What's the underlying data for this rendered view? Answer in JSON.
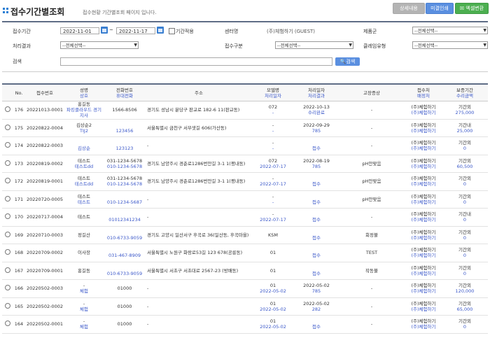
{
  "header": {
    "title": "접수기간별조회",
    "description": "접수현황 기간별조회 페이지 입니다.",
    "buttons": [
      "상세내용",
      "미결인쇄",
      "엑셀변환"
    ]
  },
  "filter": {
    "period_label": "접수기간",
    "date_from": "2022-11-01",
    "date_sep": "~",
    "date_to": "2022-11-17",
    "period_apply_label": "기간적용",
    "center_label": "센터명",
    "center_value": "(주)체험하기 (GUEST)",
    "product_label": "제품군",
    "product_value": "--전체선택--",
    "result_label": "처리결과",
    "result_value": "--전체선택--",
    "receipt_type_label": "접수구분",
    "receipt_type_value": "--전체선택--",
    "claim_type_label": "클레임유형",
    "claim_type_value": "--전체선택--",
    "search_label": "검색",
    "search_value": "",
    "search_button": "검색"
  },
  "table": {
    "headers": [
      {
        "top": "No.",
        "bottom": ""
      },
      {
        "top": "접수번호",
        "bottom": ""
      },
      {
        "top": "성명",
        "bottom": "상호"
      },
      {
        "top": "전화번호",
        "bottom": "휴대전화"
      },
      {
        "top": "주소",
        "bottom": ""
      },
      {
        "top": "모델명",
        "bottom": "처리일자"
      },
      {
        "top": "처리일자",
        "bottom": "처리결과"
      },
      {
        "top": "고장증상",
        "bottom": ""
      },
      {
        "top": "접수처",
        "bottom": "배정처"
      },
      {
        "top": "보증기간",
        "bottom": "수리금액"
      }
    ],
    "rows": [
      {
        "no": "176",
        "receipt": "20221013-0001",
        "name": "홍길동",
        "company": "파킹클라우드 경기지사",
        "phone": "1566-8506",
        "mobile": "",
        "address": "경기도 성남시 분당구 판교로 182-6 11(판교동)",
        "model": "072",
        "model_date": "-",
        "proc_date": "2022-10-13",
        "proc_result": "수리완료",
        "symptom": "-",
        "reception": "(주)체험하기",
        "assignee": "(주)체험하기",
        "warranty": "기간외",
        "amount": "275,000"
      },
      {
        "no": "175",
        "receipt": "20220822-0004",
        "name": "김상순2",
        "company": "TIJ2",
        "phone": "",
        "mobile": "123456",
        "address": "서울특별시 금천구 서부샛길 606(가산동)",
        "model": "-",
        "model_date": "-",
        "proc_date": "2022-09-29",
        "proc_result": "785",
        "symptom": "-",
        "reception": "(주)체험하기",
        "assignee": "(주)체험하기",
        "warranty": "기간내",
        "amount": "25,000"
      },
      {
        "no": "174",
        "receipt": "20220822-0003",
        "name": "",
        "company": "김상순",
        "phone": "",
        "mobile": "123123",
        "address": "-",
        "model": "-",
        "model_date": "-",
        "proc_date": "",
        "proc_result": "접수",
        "symptom": "-",
        "reception": "(주)체험하기",
        "assignee": "(주)체험하기",
        "warranty": "기간외",
        "amount": "0"
      },
      {
        "no": "173",
        "receipt": "20220819-0002",
        "name": "테스트",
        "company": "테스트dd",
        "phone": "031-1234-5678",
        "mobile": "010-1234-5678",
        "address": "경기도 남양주시 경춘로1286번안길 3-1 1(평내동)",
        "model": "072",
        "model_date": "2022-07-17",
        "proc_date": "2022-08-19",
        "proc_result": "785",
        "symptom": "pH안맞음",
        "reception": "(주)체험하기",
        "assignee": "(주)체험하기",
        "warranty": "기간외",
        "amount": "60,500"
      },
      {
        "no": "172",
        "receipt": "20220819-0001",
        "name": "테스트",
        "company": "테스트dd",
        "phone": "031-1234-5678",
        "mobile": "010-1234-5678",
        "address": "경기도 남양주시 경춘로1286번안길 3-1 1(평내동)",
        "model": "-",
        "model_date": "2022-07-17",
        "proc_date": "",
        "proc_result": "접수",
        "symptom": "pH안맞음",
        "reception": "(주)체험하기",
        "assignee": "(주)체험하기",
        "warranty": "기간외",
        "amount": "0"
      },
      {
        "no": "171",
        "receipt": "20220720-0005",
        "name": "테스트",
        "company": "테스트",
        "phone": "",
        "mobile": "010-1234-5687",
        "address": "-",
        "model": "-",
        "model_date": "-",
        "proc_date": "",
        "proc_result": "접수",
        "symptom": "pH안맞음",
        "reception": "(주)체험하기",
        "assignee": "(주)체험하기",
        "warranty": "기간외",
        "amount": "0"
      },
      {
        "no": "170",
        "receipt": "20220717-0004",
        "name": "테스트",
        "company": "",
        "phone": "",
        "mobile": "01012341234",
        "address": "-",
        "model": "-",
        "model_date": "2022-07-17",
        "proc_date": "",
        "proc_result": "접수",
        "symptom": "-",
        "reception": "(주)체험하기",
        "assignee": "(주)체험하기",
        "warranty": "기간내",
        "amount": "0"
      },
      {
        "no": "169",
        "receipt": "20220710-0003",
        "name": "정길산",
        "company": "",
        "phone": "",
        "mobile": "010-6733-9059",
        "address": "경기도 고양시 일산서구 후곡로 36(일산동, 후곡마을)",
        "model": "KSM",
        "model_date": "",
        "proc_date": "",
        "proc_result": "접수",
        "symptom": "회정불",
        "reception": "(주)체험하기",
        "assignee": "(주)체험하기",
        "warranty": "기간외",
        "amount": "0"
      },
      {
        "no": "168",
        "receipt": "20220709-0002",
        "name": "이사장",
        "company": "",
        "phone": "",
        "mobile": "031-467-8909",
        "address": "서울특별시 노원구 화랑로53길 123 678(공릉동)",
        "model": "01",
        "model_date": "",
        "proc_date": "",
        "proc_result": "접수",
        "symptom": "TEST",
        "reception": "(주)체험하기",
        "assignee": "(주)체험하기",
        "warranty": "기간외",
        "amount": "0"
      },
      {
        "no": "167",
        "receipt": "20220709-0001",
        "name": "홍길동",
        "company": "",
        "phone": "",
        "mobile": "010-6733-9059",
        "address": "서울특별시 서초구 서초대로 2567-23 (방배동)",
        "model": "01",
        "model_date": "",
        "proc_date": "",
        "proc_result": "접수",
        "symptom": "작동불",
        "reception": "(주)체험하기",
        "assignee": "(주)체험하기",
        "warranty": "기간외",
        "amount": "0"
      },
      {
        "no": "166",
        "receipt": "20220502-0003",
        "name": "-",
        "company": "체험",
        "phone": "01000",
        "mobile": "",
        "address": "-",
        "model": "01",
        "model_date": "2022-05-02",
        "proc_date": "2022-05-02",
        "proc_result": "785",
        "symptom": "-",
        "reception": "(주)체험하기",
        "assignee": "(주)체험하기",
        "warranty": "기간외",
        "amount": "120,000"
      },
      {
        "no": "165",
        "receipt": "20220502-0002",
        "name": "-",
        "company": "체험",
        "phone": "01000",
        "mobile": "",
        "address": "-",
        "model": "01",
        "model_date": "2022-05-02",
        "proc_date": "2022-05-02",
        "proc_result": "282",
        "symptom": "-",
        "reception": "(주)체험하기",
        "assignee": "(주)체험하기",
        "warranty": "기간외",
        "amount": "65,000"
      },
      {
        "no": "164",
        "receipt": "20220502-0001",
        "name": "-",
        "company": "체험",
        "phone": "01000",
        "mobile": "",
        "address": "-",
        "model": "01",
        "model_date": "2022-05-02",
        "proc_date": "",
        "proc_result": "접수",
        "symptom": "-",
        "reception": "(주)체험하기",
        "assignee": "(주)체험하기",
        "warranty": "기간외",
        "amount": "0"
      }
    ]
  }
}
